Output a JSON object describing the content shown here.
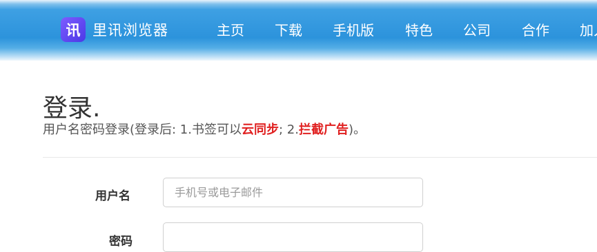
{
  "navbar": {
    "logo_text": "讯",
    "brand_name": "里讯浏览器",
    "items": [
      "主页",
      "下载",
      "手机版",
      "特色",
      "公司",
      "合作",
      "加入"
    ]
  },
  "login": {
    "title": "登录.",
    "subtitle_prefix": "用户名密码登录(登录后: 1.书签可以",
    "subtitle_highlight_1": "云同步",
    "subtitle_mid": "; 2.",
    "subtitle_highlight_2": "拦截广告",
    "subtitle_suffix": ")。",
    "username_label": "用户名",
    "username_placeholder": "手机号或电子邮件",
    "password_label": "密码"
  },
  "colors": {
    "nav_blue": "#2c93dc",
    "highlight_red": "#e02020",
    "logo_purple": "#5b45f0"
  }
}
